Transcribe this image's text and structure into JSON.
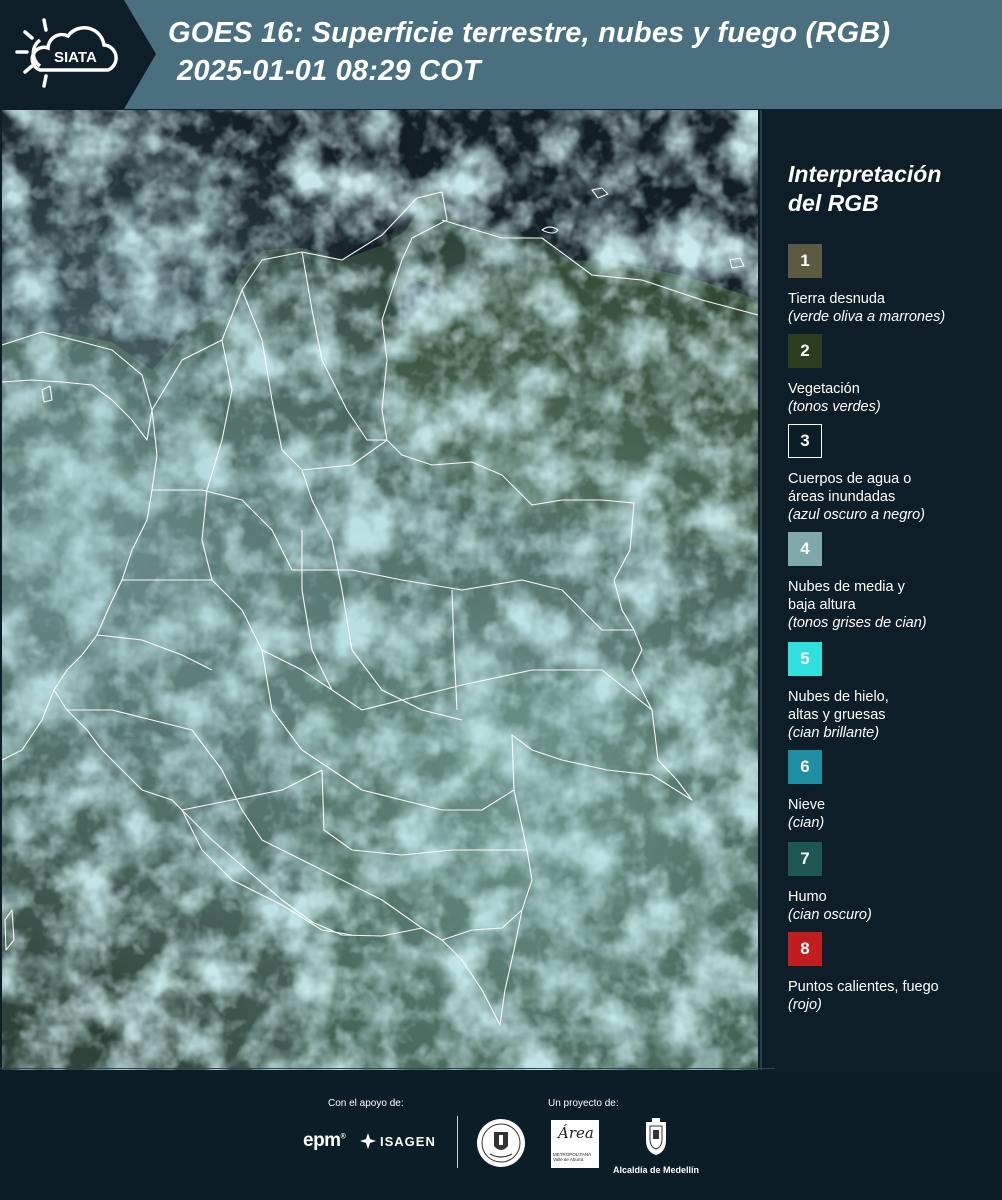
{
  "header": {
    "logo_text": "SIATA",
    "title_line1": "GOES 16: Superficie terrestre, nubes y fuego (RGB)",
    "title_line2": "2025-01-01 08:29 COT"
  },
  "legend": {
    "title": "Interpretación\ndel RGB",
    "items": [
      {
        "num": "1",
        "color": "#5c5a40",
        "label": "Tierra desnuda",
        "desc": "(verde oliva a marrones)",
        "outlined": false
      },
      {
        "num": "2",
        "color": "#2b3d1e",
        "label": "Vegetación",
        "desc": "(tonos verdes)",
        "outlined": false
      },
      {
        "num": "3",
        "color": "#0b1d27",
        "label": "Cuerpos de agua o\náreas inundadas",
        "desc": "(azul oscuro a negro)",
        "outlined": true
      },
      {
        "num": "4",
        "color": "#7fa8ab",
        "label": "Nubes de media y\nbaja altura",
        "desc": "(tonos grises de cian)",
        "outlined": false
      },
      {
        "num": "5",
        "color": "#2fe0dd",
        "label": "Nubes de hielo,\naltas y gruesas",
        "desc": "(cian brillante)",
        "outlined": false
      },
      {
        "num": "6",
        "color": "#1f8ea0",
        "label": "Nieve",
        "desc": "(cian)",
        "outlined": false
      },
      {
        "num": "7",
        "color": "#1d5653",
        "label": "Humo",
        "desc": "(cian oscuro)",
        "outlined": false
      },
      {
        "num": "8",
        "color": "#c01d1e",
        "label": "Puntos calientes, fuego",
        "desc": "(rojo)",
        "outlined": false
      }
    ]
  },
  "footer": {
    "support_label": "Con el apoyo de:",
    "project_label": "Un proyecto de:",
    "epm": "epm",
    "isagen": "ISAGEN",
    "area_word": "Área",
    "area_sub": "METROPOLITANA\nValle de Aburrá",
    "alcaldia": "Alcaldía de Medellín"
  },
  "colors": {
    "header_bg": "#4a7080",
    "page_bg": "#0e1e28",
    "vegetation": "#2b3d1e",
    "cloud_cyan": "#8fc6c8",
    "water": "#0b1620"
  }
}
